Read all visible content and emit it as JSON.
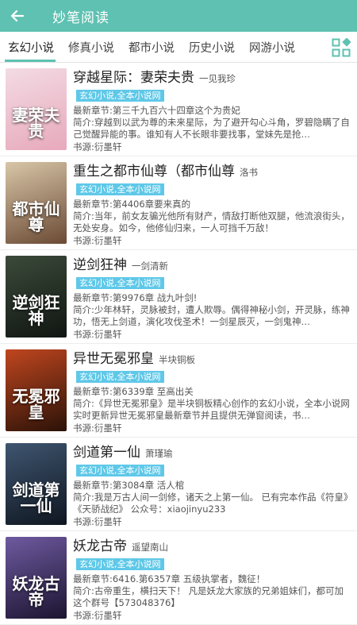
{
  "appbar": {
    "title": "妙笔阅读"
  },
  "tabs": [
    {
      "label": "玄幻小说",
      "active": true
    },
    {
      "label": "修真小说",
      "active": false
    },
    {
      "label": "都市小说",
      "active": false
    },
    {
      "label": "历史小说",
      "active": false
    },
    {
      "label": "网游小说",
      "active": false
    }
  ],
  "books": [
    {
      "name": "穿越星际：妻荣夫贵",
      "author": "一见我珍",
      "badge": "玄幻小说,全本小说网",
      "latest": "最新章节:第三千九百六十四章这个为贵妃",
      "intro": "简介:穿越到以武为尊的未来星际，为了避开勾心斗角，罗碧隐瞒了自己觉醒异能的事。谁知有人不长眼非要找事，堂妹先是抢…",
      "source": "书源:衍墨轩",
      "cover_text": "妻荣夫贵",
      "cover_bg": [
        "#f3dbe3",
        "#e7a9bc"
      ]
    },
    {
      "name": "重生之都市仙尊（都市仙尊",
      "author": "洛书",
      "badge": "玄幻小说,全本小说网",
      "latest": "最新章节:第4406章要来真的",
      "intro": "简介:当年，前女友骗光他所有财产，情敌打断他双腿，他流浪街头，无处安身。如今，他修仙归来，一人可挡千万敌！",
      "source": "书源:衍墨轩",
      "cover_text": "都市仙尊",
      "cover_bg": [
        "#d8c6a8",
        "#6b4a34"
      ]
    },
    {
      "name": "逆剑狂神",
      "author": "一剑清新",
      "badge": "玄幻小说,全本小说网",
      "latest": "最新章节:第9976章 战九叶剑!",
      "intro": "简介:少年林轩，灵脉被封，遭人欺辱。偶得神秘小剑，开灵脉，练神功，悟无上剑道，演化攻伐圣术！一剑星辰灭，一剑鬼神…",
      "source": "书源:衍墨轩",
      "cover_text": "逆剑狂神",
      "cover_bg": [
        "#3b4a3a",
        "#101612"
      ]
    },
    {
      "name": "异世无冕邪皇",
      "author": "半块铜板",
      "badge": "玄幻小说,全本小说网",
      "latest": "最新章节:第6339章 至高出关",
      "intro": "简介:《异世无冕邪皇》是半块铜板精心创作的玄幻小说，全本小说网实时更新异世无冕邪皇最新章节并且提供无弹窗阅读，书…",
      "source": "书源:衍墨轩",
      "cover_text": "无冕邪皇",
      "cover_bg": [
        "#c0461f",
        "#2b1208"
      ]
    },
    {
      "name": "剑道第一仙",
      "author": "萧瑾瑜",
      "badge": "玄幻小说,全本小说网",
      "latest": "最新章节:第3084章 活人棺",
      "intro": "简介:我是万古人间一剑修，诸天之上第一仙。 已有完本作品《符皇》《天骄战纪》 公众号：xiaojinyu233",
      "source": "书源:衍墨轩",
      "cover_text": "剑道第一仙",
      "cover_bg": [
        "#3f5570",
        "#0f1620"
      ]
    },
    {
      "name": "妖龙古帝",
      "author": "遥望南山",
      "badge": "玄幻小说,全本小说网",
      "latest": "最新章节:6416.第6357章 五级执掌者，魏征！",
      "intro": "简介:古帝重生，横扫天下！ 凡是妖龙大家族的兄弟姐妹们，都可加这个群号【573048376】",
      "source": "书源:衍墨轩",
      "cover_text": "妖龙古帝",
      "cover_bg": [
        "#6e5aa0",
        "#1c1430"
      ]
    }
  ]
}
